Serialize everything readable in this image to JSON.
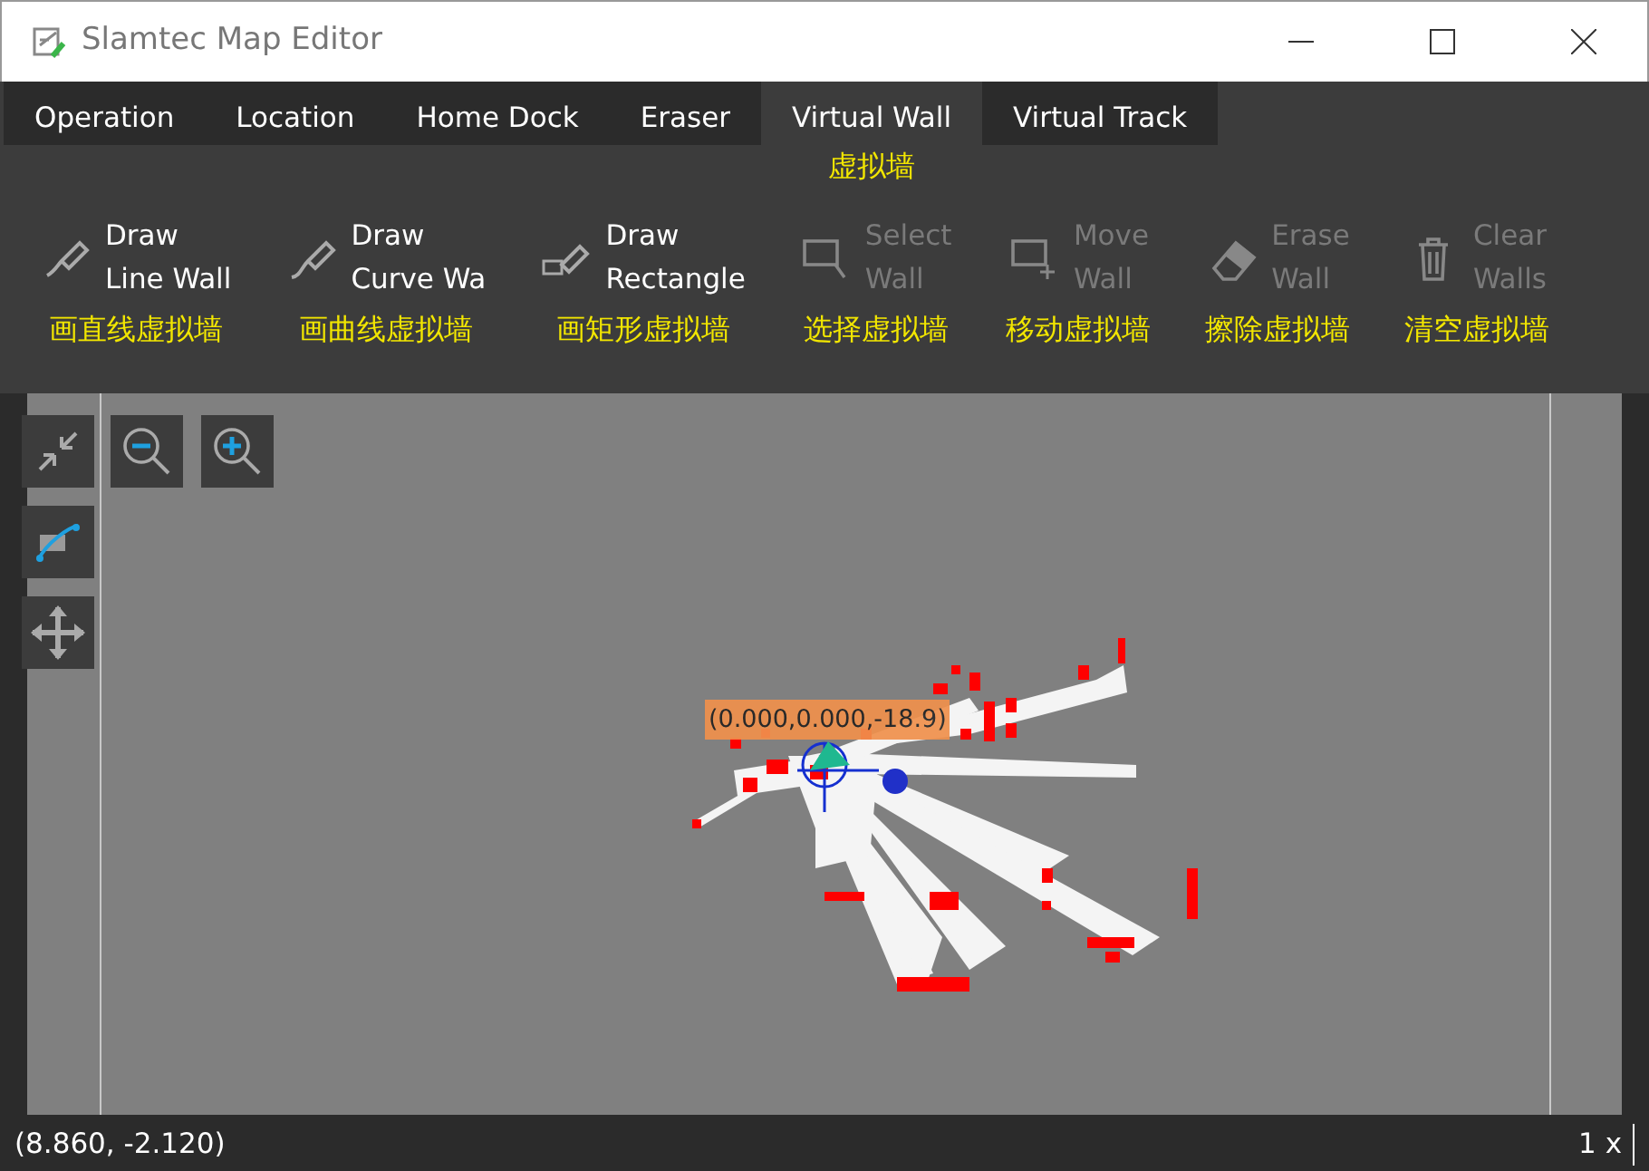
{
  "window": {
    "title": "Slamtec Map Editor"
  },
  "tabs": [
    {
      "label": "Operation",
      "selected": false
    },
    {
      "label": "Location",
      "selected": false
    },
    {
      "label": "Home Dock",
      "selected": false
    },
    {
      "label": "Eraser",
      "selected": false
    },
    {
      "label": "Virtual Wall",
      "selected": true,
      "caption": "虚拟墙"
    },
    {
      "label": "Virtual Track",
      "selected": false
    }
  ],
  "tools": [
    {
      "kind": "line",
      "lines": [
        "Draw",
        "Line Wall"
      ],
      "caption": "画直线虚拟墙",
      "disabled": false
    },
    {
      "kind": "curve",
      "lines": [
        "Draw",
        "Curve Wa"
      ],
      "caption": "画曲线虚拟墙",
      "disabled": false
    },
    {
      "kind": "rectangle",
      "lines": [
        "Draw",
        "Rectangle"
      ],
      "caption": "画矩形虚拟墙",
      "disabled": false
    },
    {
      "kind": "select",
      "lines": [
        "Select",
        "Wall"
      ],
      "caption": "选择虚拟墙",
      "disabled": true
    },
    {
      "kind": "move",
      "lines": [
        "Move",
        "Wall"
      ],
      "caption": "移动虚拟墙",
      "disabled": true
    },
    {
      "kind": "erase",
      "lines": [
        "Erase",
        "Wall"
      ],
      "caption": "擦除虚拟墙",
      "disabled": true
    },
    {
      "kind": "clear",
      "lines": [
        "Clear",
        "Walls"
      ],
      "caption": "清空虚拟墙",
      "disabled": true
    }
  ],
  "map": {
    "pose_label": "(0.000,0.000,-18.9)"
  },
  "status_bar": {
    "coordinates": "(8.860, -2.120)",
    "zoom": "1 x"
  }
}
